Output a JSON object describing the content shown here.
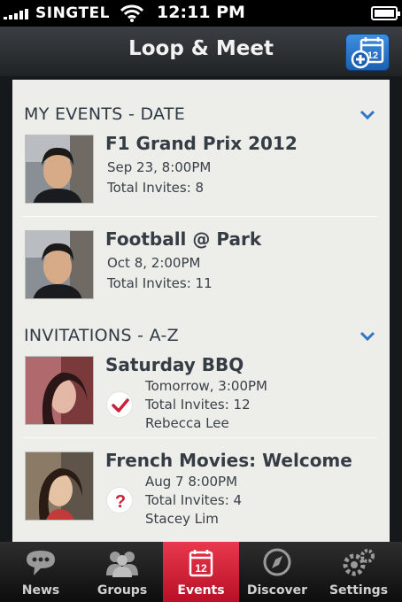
{
  "status_bar": {
    "carrier": "SINGTEL",
    "time": "12:11 PM",
    "signal_bars": 5,
    "battery_level": 1.0
  },
  "nav": {
    "title": "Loop & Meet",
    "add_event_badge": "12",
    "add_event_icon": "calendar-add-icon"
  },
  "sections": [
    {
      "title": "MY EVENTS - DATE",
      "collapse_icon": "chevron-down-icon",
      "events": [
        {
          "title": "F1 Grand Prix 2012",
          "datetime": "Sep 23, 8:00PM",
          "invites": "Total Invites: 8",
          "avatar": "avatar-man-icon"
        },
        {
          "title": "Football @ Park",
          "datetime": "Oct 8, 2:00PM",
          "invites": "Total Invites: 11",
          "avatar": "avatar-man-icon"
        }
      ]
    },
    {
      "title": "INVITATIONS - A-Z",
      "collapse_icon": "chevron-down-icon",
      "events": [
        {
          "title": "Saturday BBQ",
          "datetime": "Tomorrow, 3:00PM",
          "invites": "Total Invites: 12",
          "host": "Rebecca Lee",
          "status": "accepted",
          "status_icon": "check-icon",
          "avatar": "avatar-woman-icon"
        },
        {
          "title": "French Movies: Welcome",
          "datetime": "Aug 7 8:00PM",
          "invites": "Total Invites: 4",
          "host": "Stacey Lim",
          "status": "pending",
          "status_icon": "question-icon",
          "avatar": "avatar-woman-icon"
        }
      ]
    }
  ],
  "tabs": [
    {
      "label": "News",
      "icon": "speech-bubble-icon",
      "active": false
    },
    {
      "label": "Groups",
      "icon": "people-icon",
      "active": false
    },
    {
      "label": "Events",
      "icon": "calendar-icon",
      "active": true,
      "badge": "12"
    },
    {
      "label": "Discover",
      "icon": "compass-icon",
      "active": false
    },
    {
      "label": "Settings",
      "icon": "gears-icon",
      "active": false
    }
  ],
  "colors": {
    "accent_red": "#d42a3e",
    "nav_blue": "#2f7fd6",
    "panel_bg": "#ededea"
  }
}
